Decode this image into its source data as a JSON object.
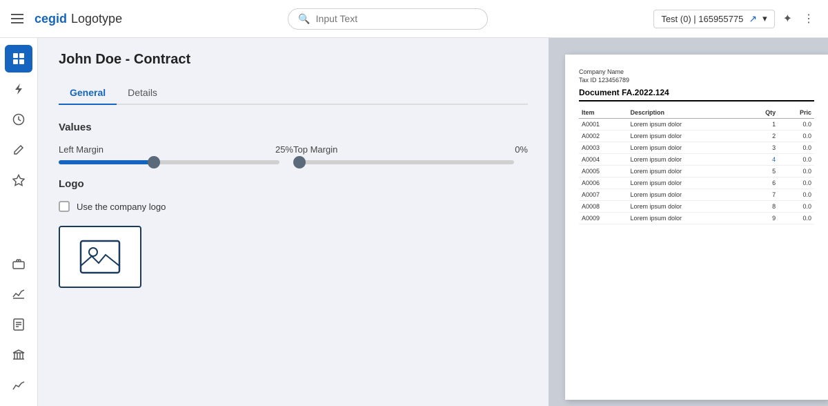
{
  "header": {
    "menu_icon_label": "menu",
    "logo_brand": "cegid",
    "logo_type": " Logotype",
    "search_placeholder": "Input Text",
    "account": {
      "label": "Test (0) | 165955775"
    }
  },
  "sidebar": {
    "items": [
      {
        "id": "grid",
        "icon": "⊞",
        "active": true
      },
      {
        "id": "bolt",
        "icon": "⚡",
        "active": false
      },
      {
        "id": "clock",
        "icon": "🕐",
        "active": false
      },
      {
        "id": "edit",
        "icon": "✏️",
        "active": false
      },
      {
        "id": "star",
        "icon": "★",
        "active": false
      },
      {
        "id": "briefcase",
        "icon": "💼",
        "active": false
      },
      {
        "id": "chart-line",
        "icon": "📈",
        "active": false
      },
      {
        "id": "doc-check",
        "icon": "📋",
        "active": false
      },
      {
        "id": "bank",
        "icon": "🏛",
        "active": false
      },
      {
        "id": "analytics",
        "icon": "📊",
        "active": false
      }
    ]
  },
  "page": {
    "title": "John Doe - Contract",
    "tabs": [
      {
        "id": "general",
        "label": "General",
        "active": true
      },
      {
        "id": "details",
        "label": "Details",
        "active": false
      }
    ],
    "sections": {
      "values": {
        "title": "Values",
        "left_margin": {
          "label": "Left Margin",
          "value": "25%",
          "fill_percent": 43,
          "thumb_percent": 43
        },
        "top_margin": {
          "label": "Top Margin",
          "value": "0%",
          "fill_percent": 0,
          "thumb_percent": 0
        }
      },
      "logo": {
        "title": "Logo",
        "checkbox_label": "Use the company logo",
        "checked": false
      }
    },
    "document_preview": {
      "company_name": "Company Name",
      "tax_id": "Tax ID 123456789",
      "document_title": "Document FA.2022.124",
      "table_headers": [
        "Item",
        "Description",
        "Qty",
        "Pric"
      ],
      "table_rows": [
        {
          "item": "A0001",
          "desc": "Lorem ipsum dolor",
          "qty": "1",
          "price": "0.0",
          "highlight": false
        },
        {
          "item": "A0002",
          "desc": "Lorem ipsum dolor",
          "qty": "2",
          "price": "0.0",
          "highlight": false
        },
        {
          "item": "A0003",
          "desc": "Lorem ipsum dolor",
          "qty": "3",
          "price": "0.0",
          "highlight": false
        },
        {
          "item": "A0004",
          "desc": "Lorem ipsum dolor",
          "qty": "4",
          "price": "0.0",
          "highlight": true
        },
        {
          "item": "A0005",
          "desc": "Lorem ipsum dolor",
          "qty": "5",
          "price": "0.0",
          "highlight": false
        },
        {
          "item": "A0006",
          "desc": "Lorem ipsum dolor",
          "qty": "6",
          "price": "0.0",
          "highlight": false
        },
        {
          "item": "A0007",
          "desc": "Lorem ipsum dolor",
          "qty": "7",
          "price": "0.0",
          "highlight": false
        },
        {
          "item": "A0008",
          "desc": "Lorem ipsum dolor",
          "qty": "8",
          "price": "0.0",
          "highlight": false
        },
        {
          "item": "A0009",
          "desc": "Lorem ipsum dolor",
          "qty": "9",
          "price": "0.0",
          "highlight": false
        }
      ]
    }
  },
  "icons": {
    "menu": "☰",
    "search": "🔍",
    "external_link": "↗",
    "chevron_down": "▾",
    "sparkle": "✦",
    "more": "⋮"
  }
}
